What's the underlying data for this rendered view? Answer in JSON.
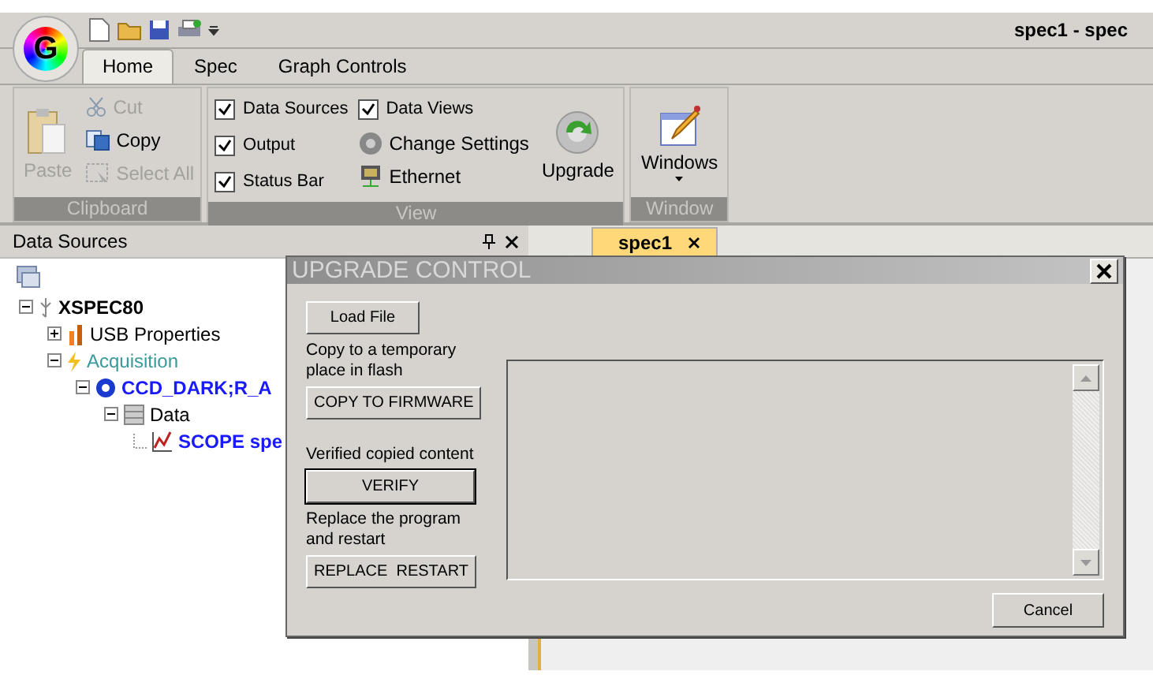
{
  "window": {
    "title": "spec1 - spec",
    "logo": "G"
  },
  "ribbon_tabs": [
    {
      "label": "Home",
      "selected": true
    },
    {
      "label": "Spec",
      "selected": false
    },
    {
      "label": "Graph Controls",
      "selected": false
    }
  ],
  "ribbon_groups": [
    {
      "label": "Clipboard",
      "columns": [
        [
          {
            "kind": "large",
            "label": "Paste",
            "disabled": true
          }
        ],
        [
          {
            "kind": "small",
            "label": "Cut",
            "disabled": true
          },
          {
            "kind": "small",
            "label": "Copy",
            "disabled": false
          },
          {
            "kind": "small",
            "label": "Select All",
            "disabled": true
          }
        ]
      ]
    },
    {
      "label": "View",
      "columns": [
        [
          {
            "kind": "check",
            "label": "Data Sources",
            "checked": true
          },
          {
            "kind": "check",
            "label": "Output",
            "checked": true
          },
          {
            "kind": "check",
            "label": "Status Bar",
            "checked": true
          }
        ],
        [
          {
            "kind": "check",
            "label": "Data Views",
            "checked": true
          },
          {
            "kind": "small",
            "label": "Change Settings",
            "disabled": false
          },
          {
            "kind": "small",
            "label": "Ethernet",
            "disabled": false
          }
        ],
        [
          {
            "kind": "large",
            "label": "Upgrade",
            "disabled": false
          }
        ]
      ]
    },
    {
      "label": "Window",
      "columns": [
        [
          {
            "kind": "dropdown",
            "label": "Windows",
            "disabled": false
          }
        ]
      ]
    }
  ],
  "data_sources": {
    "title": "Data Sources",
    "tree": [
      {
        "kind": "device",
        "label": "XSPEC80",
        "expanded": true,
        "children": [
          {
            "kind": "properties",
            "label": "USB Properties",
            "expanded": false
          },
          {
            "kind": "acquisition",
            "label": "Acquisition",
            "expanded": true,
            "children": [
              {
                "kind": "config",
                "label": "CCD_DARK;R_A",
                "expanded": true,
                "children": [
                  {
                    "kind": "data",
                    "label": "Data",
                    "expanded": true,
                    "children": [
                      {
                        "kind": "graph",
                        "label": "SCOPE spe"
                      }
                    ]
                  }
                ]
              }
            ]
          }
        ]
      }
    ]
  },
  "document_tabs": [
    {
      "label": "spec1",
      "selected": true
    }
  ],
  "dialog": {
    "title": "UPGRADE CONTROL",
    "steps": [
      {
        "button": "Load File",
        "default": false
      },
      {
        "caption": "Copy to a temporary place in flash",
        "button": "COPY TO FIRMWARE",
        "default": false
      },
      {
        "caption": "Verified copied content",
        "button": "VERIFY",
        "default": true
      },
      {
        "caption": "Replace the program and restart",
        "button": "REPLACE  RESTART",
        "default": false
      }
    ],
    "cancel": "Cancel"
  }
}
